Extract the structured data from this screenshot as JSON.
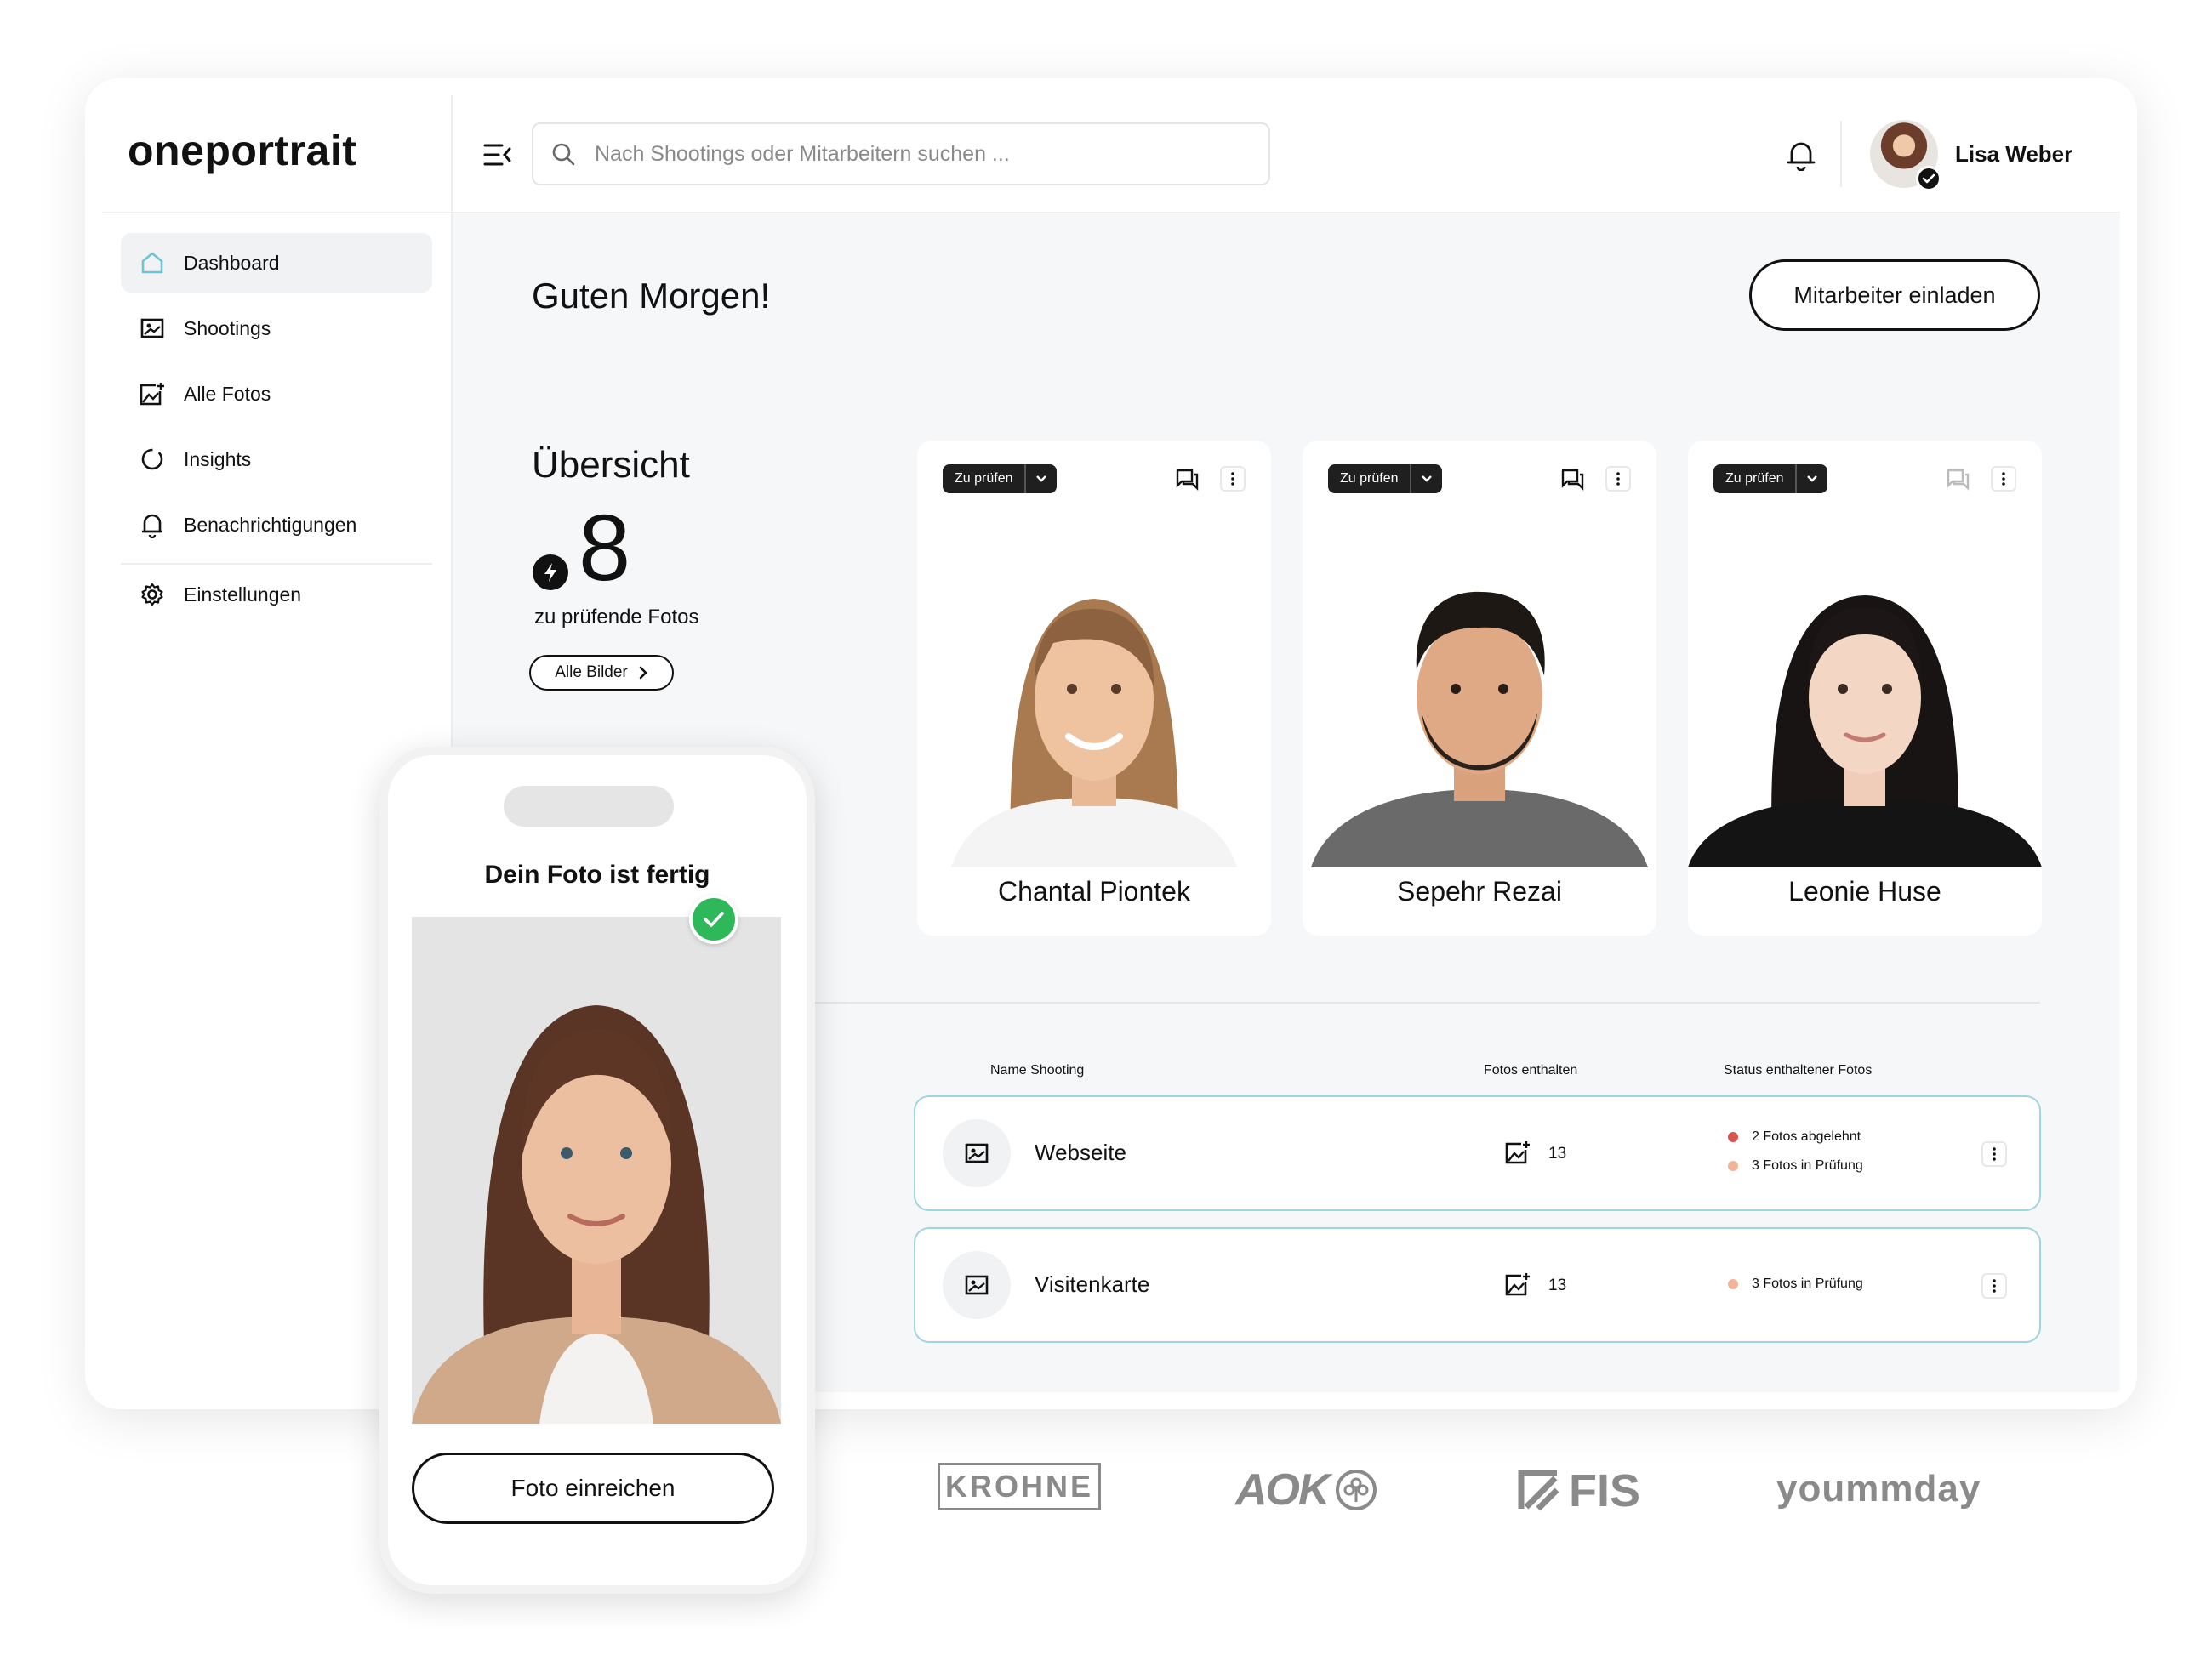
{
  "brand": {
    "logo": "oneportrait"
  },
  "search": {
    "placeholder": "Nach Shootings oder Mitarbeitern suchen ..."
  },
  "user": {
    "name": "Lisa Weber"
  },
  "sidebar": {
    "items": [
      {
        "label": "Dashboard",
        "icon": "home-icon",
        "active": true
      },
      {
        "label": "Shootings",
        "icon": "folder-image-icon"
      },
      {
        "label": "Alle Fotos",
        "icon": "image-plus-icon"
      },
      {
        "label": "Insights",
        "icon": "loading-circle-icon"
      },
      {
        "label": "Benachrichtigungen",
        "icon": "bell-icon"
      },
      {
        "label": "Einstellungen",
        "icon": "gear-icon"
      }
    ]
  },
  "main": {
    "greeting": "Guten Morgen!",
    "invite_button": "Mitarbeiter einladen",
    "overview": {
      "title": "Übersicht",
      "count": "8",
      "count_label": "zu prüfende Fotos",
      "all_button": "Alle Bilder"
    },
    "cards": [
      {
        "status": "Zu prüfen",
        "name": "Chantal Piontek"
      },
      {
        "status": "Zu prüfen",
        "name": "Sepehr Rezai"
      },
      {
        "status": "Zu prüfen",
        "name": "Leonie Huse"
      }
    ],
    "table": {
      "headers": [
        "Name Shooting",
        "Fotos enthalten",
        "Status enthaltener Fotos"
      ],
      "rows": [
        {
          "name": "Webseite",
          "photos": "13",
          "statuses": [
            {
              "text": "2 Fotos abgelehnt",
              "color": "#d9534f"
            },
            {
              "text": "3 Fotos in Prüfung",
              "color": "#f0b49a"
            }
          ]
        },
        {
          "name": "Visitenkarte",
          "photos": "13",
          "statuses": [
            {
              "text": "3 Fotos in Prüfung",
              "color": "#f0b49a"
            }
          ]
        }
      ]
    }
  },
  "phone": {
    "title": "Dein Foto ist fertig",
    "submit_button": "Foto einreichen"
  },
  "logos": [
    "KROHNE",
    "AOK",
    "FIS",
    "yoummday"
  ],
  "colors": {
    "accent": "#9fd4e0",
    "success": "#2fb85a",
    "dark": "#111111"
  }
}
